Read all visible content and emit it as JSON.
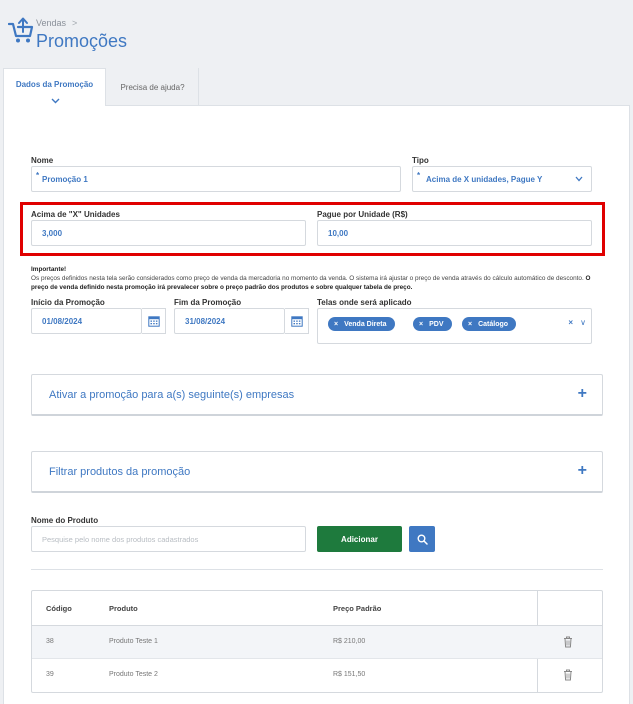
{
  "header": {
    "breadcrumb": "Vendas",
    "breadcrumb_sep": ">",
    "title": "Promoções"
  },
  "tabs": [
    {
      "label": "Dados da Promoção",
      "active": true
    },
    {
      "label": "Precisa de ajuda?",
      "active": false
    }
  ],
  "form": {
    "nome": {
      "label": "Nome",
      "value": "Promoção 1",
      "required": "*"
    },
    "tipo": {
      "label": "Tipo",
      "value": "Acima de X unidades, Pague Y",
      "required": "*"
    },
    "acima": {
      "label": "Acima de \"X\" Unidades",
      "value": "3,000"
    },
    "pague": {
      "label": "Pague por Unidade (R$)",
      "value": "10,00"
    },
    "note": {
      "title": "Importante!",
      "text": "Os preços definidos nesta tela serão considerados como preço de venda da mercadoria no momento da venda. O sistema irá ajustar o preço de venda através do cálculo automático de desconto.",
      "bold": "O preço de venda definido nesta promoção irá prevalecer sobre o preço padrão dos produtos e sobre qualquer tabela de preço."
    },
    "inicio": {
      "label": "Início da Promoção",
      "value": "01/08/2024"
    },
    "fim": {
      "label": "Fim da Promoção",
      "value": "31/08/2024"
    },
    "telas": {
      "label": "Telas onde será aplicado",
      "chips": [
        "Venda Direta",
        "PDV",
        "Catálogo"
      ],
      "chip_remove": "×",
      "clear": "×",
      "dropdown": "∨"
    }
  },
  "accordions": {
    "empresas": {
      "label": "Ativar a promoção para a(s) seguinte(s) empresas",
      "toggle": "+"
    },
    "produtos": {
      "label": "Filtrar produtos da promoção",
      "toggle": "+"
    }
  },
  "product_search": {
    "label": "Nome do Produto",
    "placeholder": "Pesquise pelo nome dos produtos cadastrados",
    "add_label": "Adicionar"
  },
  "table": {
    "headers": {
      "codigo": "Código",
      "produto": "Produto",
      "preco": "Preço Padrão"
    },
    "rows": [
      {
        "codigo": "38",
        "produto": "Produto Teste 1",
        "preco": "R$ 210,00"
      },
      {
        "codigo": "39",
        "produto": "Produto Teste 2",
        "preco": "R$ 151,50"
      }
    ]
  },
  "colors": {
    "accent": "#3f78c2",
    "success": "#1e7a3d",
    "highlight": "#e00000"
  }
}
